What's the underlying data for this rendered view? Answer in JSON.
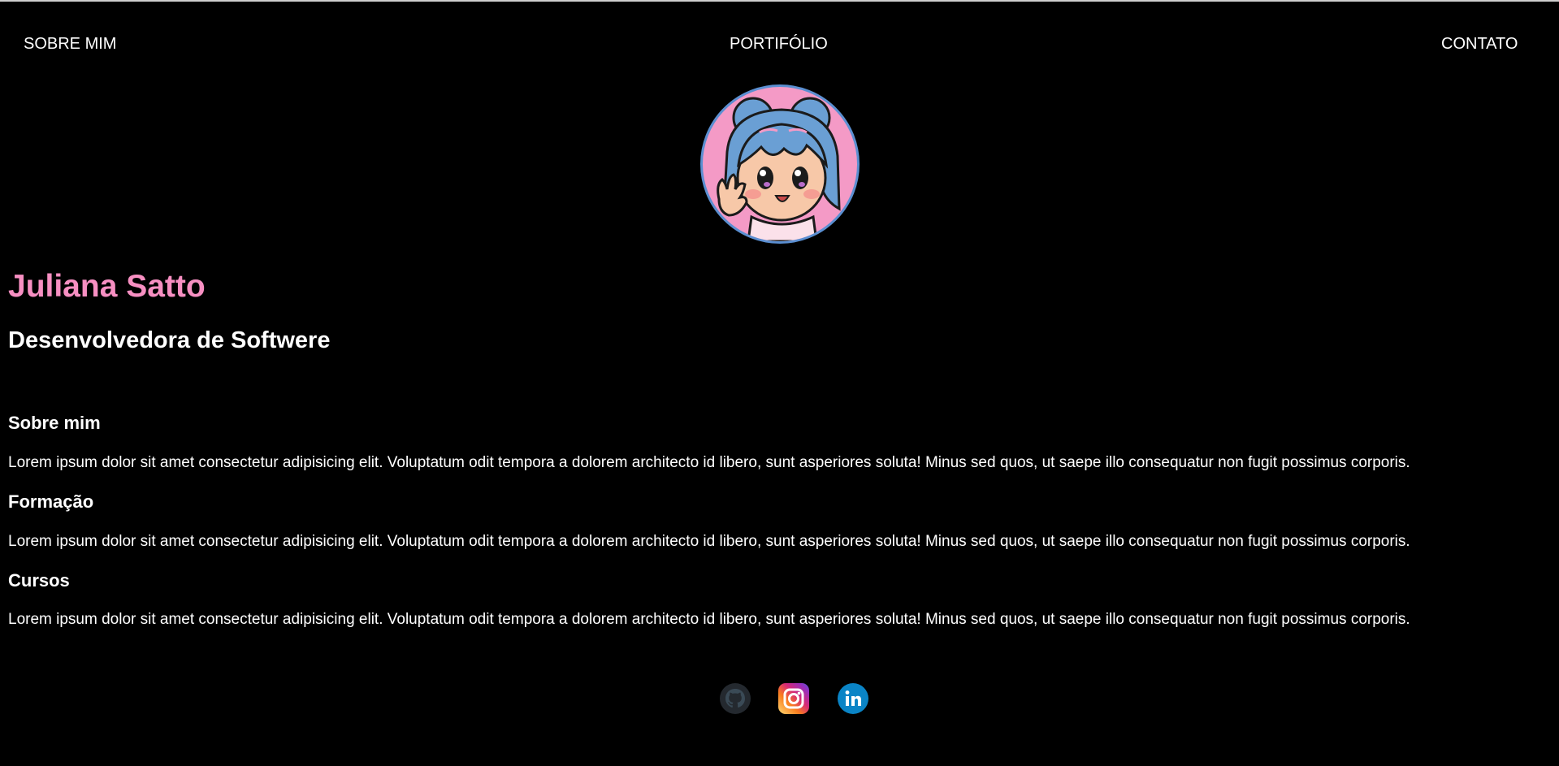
{
  "nav": {
    "items": [
      {
        "label": "SOBRE MIM"
      },
      {
        "label": "PORTIFÓLIO"
      },
      {
        "label": "CONTATO"
      }
    ]
  },
  "profile": {
    "name": "Juliana Satto",
    "role": "Desenvolvedora de Softwere",
    "avatar_icon": "anime-girl-avatar"
  },
  "sections": [
    {
      "title": "Sobre mim",
      "text": "Lorem ipsum dolor sit amet consectetur adipisicing elit. Voluptatum odit tempora a dolorem architecto id libero, sunt asperiores soluta! Minus sed quos, ut saepe illo consequatur non fugit possimus corporis."
    },
    {
      "title": "Formação",
      "text": "Lorem ipsum dolor sit amet consectetur adipisicing elit. Voluptatum odit tempora a dolorem architecto id libero, sunt asperiores soluta! Minus sed quos, ut saepe illo consequatur non fugit possimus corporis."
    },
    {
      "title": "Cursos",
      "text": "Lorem ipsum dolor sit amet consectetur adipisicing elit. Voluptatum odit tempora a dolorem architecto id libero, sunt asperiores soluta! Minus sed quos, ut saepe illo consequatur non fugit possimus corporis."
    }
  ],
  "social": [
    {
      "icon": "github-icon"
    },
    {
      "icon": "instagram-icon"
    },
    {
      "icon": "linkedin-icon"
    }
  ],
  "colors": {
    "background": "#000000",
    "accent_name": "#f78fc2",
    "text": "#ffffff",
    "avatar_bg": "#f49ac6",
    "avatar_border": "#5b8fd1"
  }
}
